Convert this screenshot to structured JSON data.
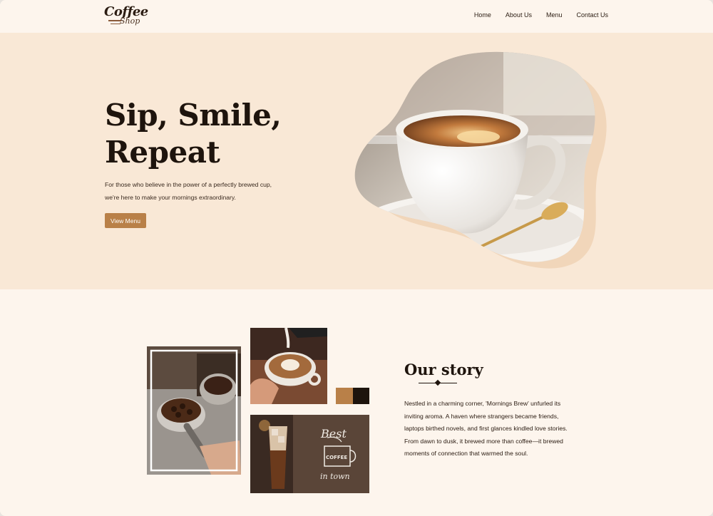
{
  "brand": {
    "line1": "Coffee",
    "line2": "Shop"
  },
  "nav": {
    "items": [
      "Home",
      "About Us",
      "Menu",
      "Contact Us"
    ]
  },
  "hero": {
    "title_line1": "Sip, Smile,",
    "title_line2": "Repeat",
    "description": "For those who believe in the power of a perfectly brewed cup, we're here to make your mornings extraordinary.",
    "cta_label": "View Menu"
  },
  "story": {
    "title": "Our story",
    "text": "Nestled in a charming corner, 'Mornings Brew' unfurled its inviting aroma. A haven where strangers became friends, laptops birthed novels, and first glances kindled love stories. From dawn to dusk, it brewed more than coffee—it brewed moments of connection that warmed the soul.",
    "sign_best": "Best",
    "sign_coffee": "COFFEE",
    "sign_town": "in town"
  },
  "colors": {
    "accent": "#b98048",
    "dark": "#1e140d",
    "hero_bg": "#f9e8d6",
    "page_bg": "#fdf5ed"
  },
  "icons": [
    "coffee-cup-illustration",
    "portafilter-photo",
    "latte-art-photo",
    "iced-coffee-photo"
  ]
}
